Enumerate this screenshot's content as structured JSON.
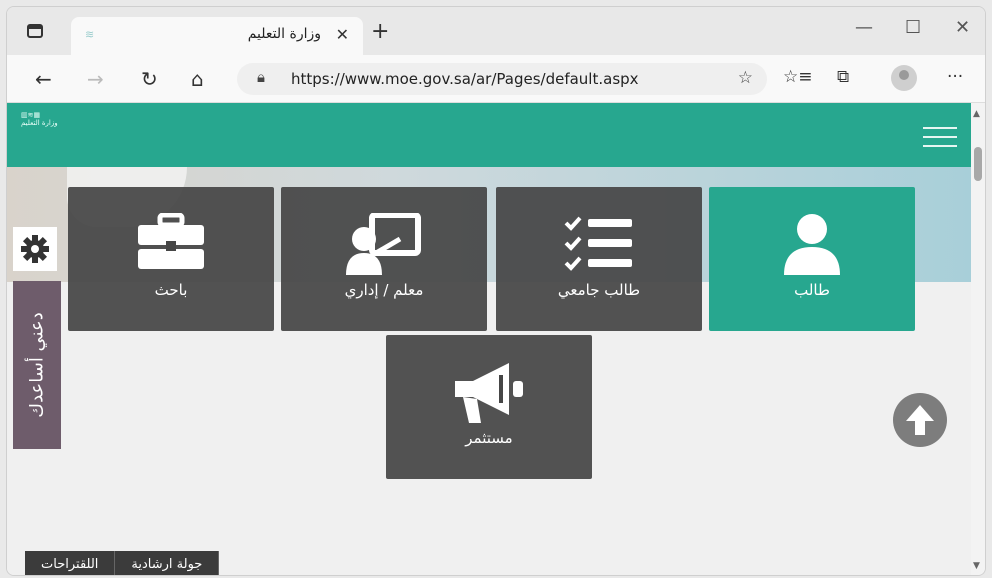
{
  "browser": {
    "tab_title": "وزارة التعليم",
    "tab_close": "✕",
    "new_tab": "+",
    "url": "https://www.moe.gov.sa/ar/Pages/default.aspx",
    "more": "···",
    "min": "—",
    "max": "☐",
    "close": "✕"
  },
  "site": {
    "logo_text": "وزارة التعليم",
    "tiles": [
      {
        "label": "طالب",
        "icon": "user-icon",
        "active": true
      },
      {
        "label": "طالب جامعي",
        "icon": "checklist-icon",
        "active": false
      },
      {
        "label": "معلم / إداري",
        "icon": "teacher-board-icon",
        "active": false
      },
      {
        "label": "باحث",
        "icon": "briefcase-icon",
        "active": false
      },
      {
        "label": "مستثمر",
        "icon": "megaphone-icon",
        "active": false
      }
    ],
    "help_label": "دعني أساعدك",
    "bottom_tabs": [
      "اللقتراحات",
      "جولة ارشادية"
    ]
  },
  "colors": {
    "header": "#27a78f",
    "tile_active": "#27a78f",
    "tile": "#464646",
    "help": "#6e5c6b"
  }
}
